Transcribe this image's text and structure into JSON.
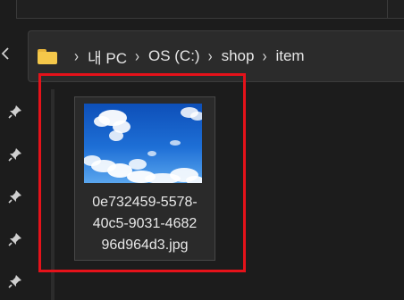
{
  "address_bar": {
    "crumbs": [
      "내 PC",
      "OS (C:)",
      "shop",
      "item"
    ],
    "separator": "›"
  },
  "nav": {
    "back_chevron": "‹"
  },
  "quick_access": {
    "pins": [
      "pin-icon",
      "pin-icon",
      "pin-icon",
      "pin-icon",
      "pin-icon"
    ]
  },
  "file": {
    "name": "0e732459-5578-\n40c5-9031-4682\n96d964d3.jpg",
    "thumbnail": "sky-clouds-thumbnail"
  },
  "colors": {
    "background": "#1c1c1c",
    "address_bar_bg": "#2b2b2b",
    "selection_highlight": "#e5121a",
    "folder_yellow": "#f5c84a"
  }
}
